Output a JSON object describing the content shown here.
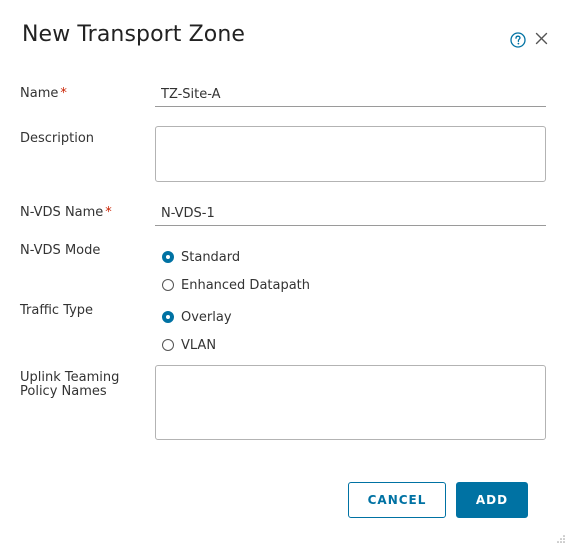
{
  "dialog": {
    "title": "New Transport Zone",
    "help_icon": "help-circle-icon",
    "close_icon": "close-icon"
  },
  "form": {
    "name": {
      "label": "Name",
      "required_mark": "*",
      "value": "TZ-Site-A"
    },
    "description": {
      "label": "Description",
      "value": ""
    },
    "nvds_name": {
      "label": "N-VDS Name",
      "required_mark": "*",
      "value": "N-VDS-1"
    },
    "nvds_mode": {
      "label": "N-VDS Mode",
      "options": [
        "Standard",
        "Enhanced Datapath"
      ],
      "selected": "Standard"
    },
    "traffic_type": {
      "label": "Traffic Type",
      "options": [
        "Overlay",
        "VLAN"
      ],
      "selected": "Overlay"
    },
    "uplink_policy": {
      "label_line1": "Uplink Teaming",
      "label_line2": "Policy Names",
      "value": ""
    }
  },
  "buttons": {
    "cancel": "CANCEL",
    "add": "ADD"
  },
  "colors": {
    "accent": "#0072a3",
    "required": "#c92100",
    "text": "#333333"
  }
}
